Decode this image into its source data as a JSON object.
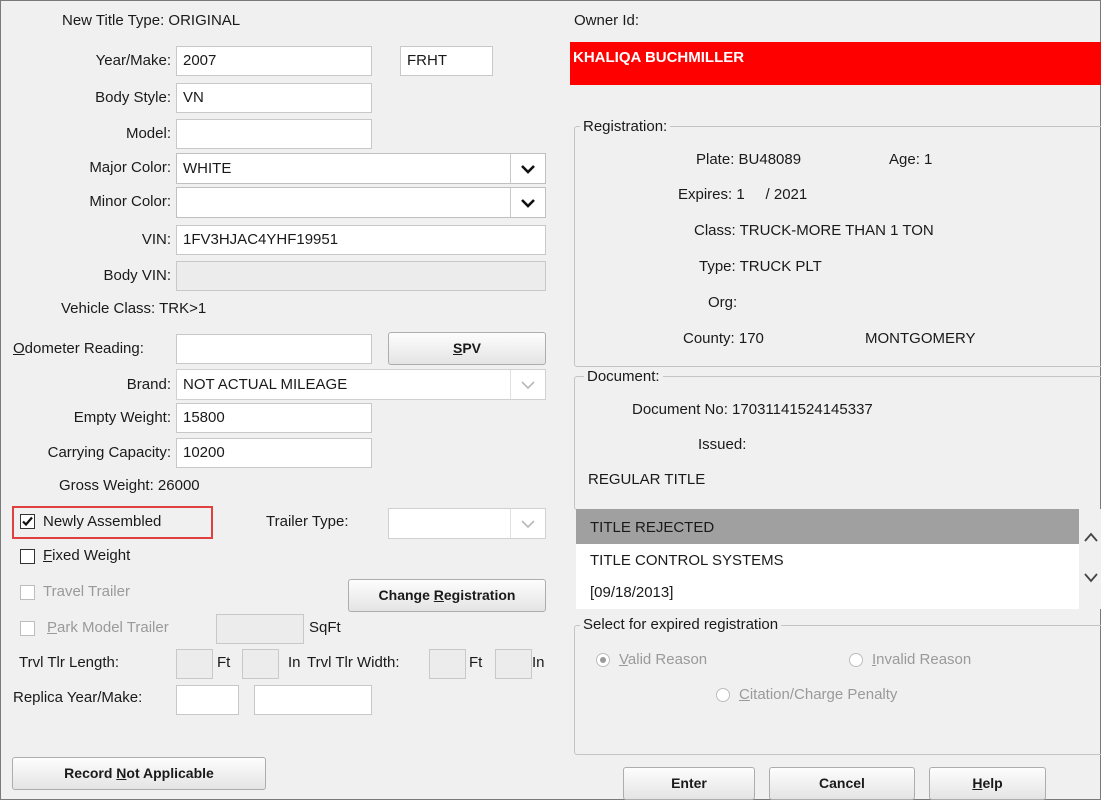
{
  "colors": {
    "owner_banner": "#ff0000",
    "owner_text": "#ffffff",
    "highlight_box": "#e04040",
    "selected_row": "#a0a0a0"
  },
  "left": {
    "title_type_label": "New Title Type: ORIGINAL",
    "year_make_label": "Year/Make:",
    "year_value": "2007",
    "make_value": "FRHT",
    "body_style_label": "Body Style:",
    "body_style_value": "VN",
    "model_label": "Model:",
    "model_value": "",
    "major_color_label": "Major Color:",
    "major_color_value": "WHITE",
    "minor_color_label": "Minor Color:",
    "minor_color_value": "",
    "vin_label": "VIN:",
    "vin_value": "1FV3HJAC4YHF19951",
    "body_vin_label": "Body VIN:",
    "body_vin_value": "",
    "vehicle_class_label": "Vehicle Class: TRK>1",
    "odometer_label_u": "O",
    "odometer_label_rest": "dometer Reading:",
    "odometer_value": "",
    "spv_u": "S",
    "spv_rest": "PV",
    "brand_label": "Brand:",
    "brand_value": "NOT ACTUAL MILEAGE",
    "empty_weight_label": "Empty Weight:",
    "empty_weight_value": "15800",
    "carrying_capacity_label": "Carrying Capacity:",
    "carrying_capacity_value": "10200",
    "gross_weight_label": "Gross Weight: 26000",
    "newly_assembled_label": "Newly Assembled",
    "newly_assembled_checked": true,
    "trailer_type_label": "Trailer Type:",
    "trailer_type_value": "",
    "fixed_weight_u": "F",
    "fixed_weight_rest": "ixed Weight",
    "travel_trailer_label": "Travel Trailer",
    "change_registration_prefix": "Change ",
    "change_registration_u": "R",
    "change_registration_rest": "egistration",
    "park_model_u": "P",
    "park_model_rest": "ark Model Trailer",
    "sqft_label": "SqFt",
    "trvl_length_label": "Trvl Tlr Length:",
    "ft_label": "Ft",
    "in_label": "In",
    "trvl_width_label": "Trvl Tlr Width:",
    "ft_label2": "Ft",
    "in_label2": "In",
    "replica_label": "Replica Year/Make:",
    "record_na_prefix": "Record ",
    "record_na_u": "N",
    "record_na_rest": "ot Applicable"
  },
  "right": {
    "owner_id_label": "Owner Id:",
    "owner_name": "KHALIQA BUCHMILLER",
    "registration_title": "Registration:",
    "plate": "Plate: BU48089",
    "age": "Age: 1",
    "expires": "Expires: 1     / 2021",
    "class": "Class: TRUCK-MORE THAN 1 TON",
    "type": "Type: TRUCK PLT",
    "org": "Org:",
    "county": "County: 170",
    "county_name": "MONTGOMERY",
    "document_title": "Document:",
    "document_no": "Document No: 17031141524145337",
    "issued": "Issued:",
    "regular_title": "REGULAR TITLE",
    "list_items": [
      "TITLE REJECTED",
      "TITLE CONTROL SYSTEMS",
      "[09/18/2013]"
    ],
    "expired_title": "Select for expired registration",
    "valid_u": "V",
    "valid_rest": "alid Reason",
    "invalid_u": "I",
    "invalid_rest": "nvalid Reason",
    "citation_u": "C",
    "citation_rest": "itation/Charge Penalty"
  },
  "footer": {
    "enter": "Enter",
    "cancel": "Cancel",
    "help_u": "H",
    "help_rest": "elp"
  }
}
